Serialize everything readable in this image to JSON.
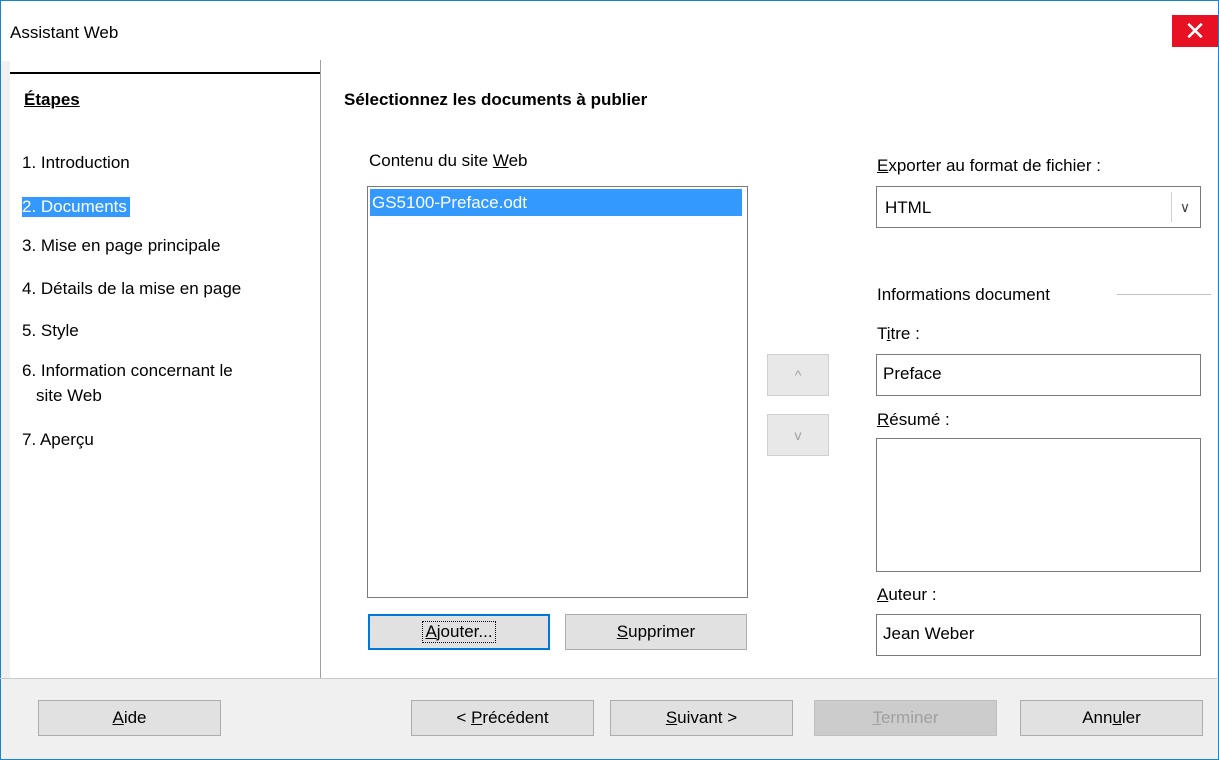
{
  "window": {
    "title": "Assistant Web",
    "close_icon": "close-icon"
  },
  "steps": {
    "heading": "Étapes",
    "items": [
      "1. Introduction",
      "2. Documents",
      "3. Mise en page principale",
      "4. Détails de la mise en page",
      "5. Style",
      "6. Information concernant le",
      "site Web",
      "7. Aperçu"
    ],
    "selected_index": 1
  },
  "main": {
    "title": "Sélectionnez les documents à publier",
    "content_label_pre": "Contenu du site ",
    "content_label_mn": "W",
    "content_label_post": "eb",
    "documents": [
      "GS5100-Preface.odt"
    ],
    "add_button_mn": "A",
    "add_button_rest": "jouter...",
    "remove_button_mn": "S",
    "remove_button_rest": "upprimer",
    "up_icon": "^",
    "down_icon": "v"
  },
  "export": {
    "label_mn": "E",
    "label_rest": "xporter au format de fichier :",
    "value": "HTML"
  },
  "docinfo": {
    "group_label": "Informations document",
    "title_label_pre": "T",
    "title_label_mn": "i",
    "title_label_post": "tre :",
    "title_value": "Preface",
    "summary_label_mn": "R",
    "summary_label_rest": "ésumé :",
    "summary_value": "",
    "author_label_mn": "A",
    "author_label_rest": "uteur :",
    "author_value": "Jean Weber"
  },
  "footer": {
    "help_mn": "A",
    "help_rest": "ide",
    "prev_pre": "< ",
    "prev_mn": "P",
    "prev_rest": "récédent",
    "next_mn": "S",
    "next_rest": "uivant >",
    "finish_mn": "T",
    "finish_rest": "erminer",
    "cancel_pre": "Ann",
    "cancel_mn": "u",
    "cancel_post": "ler"
  }
}
